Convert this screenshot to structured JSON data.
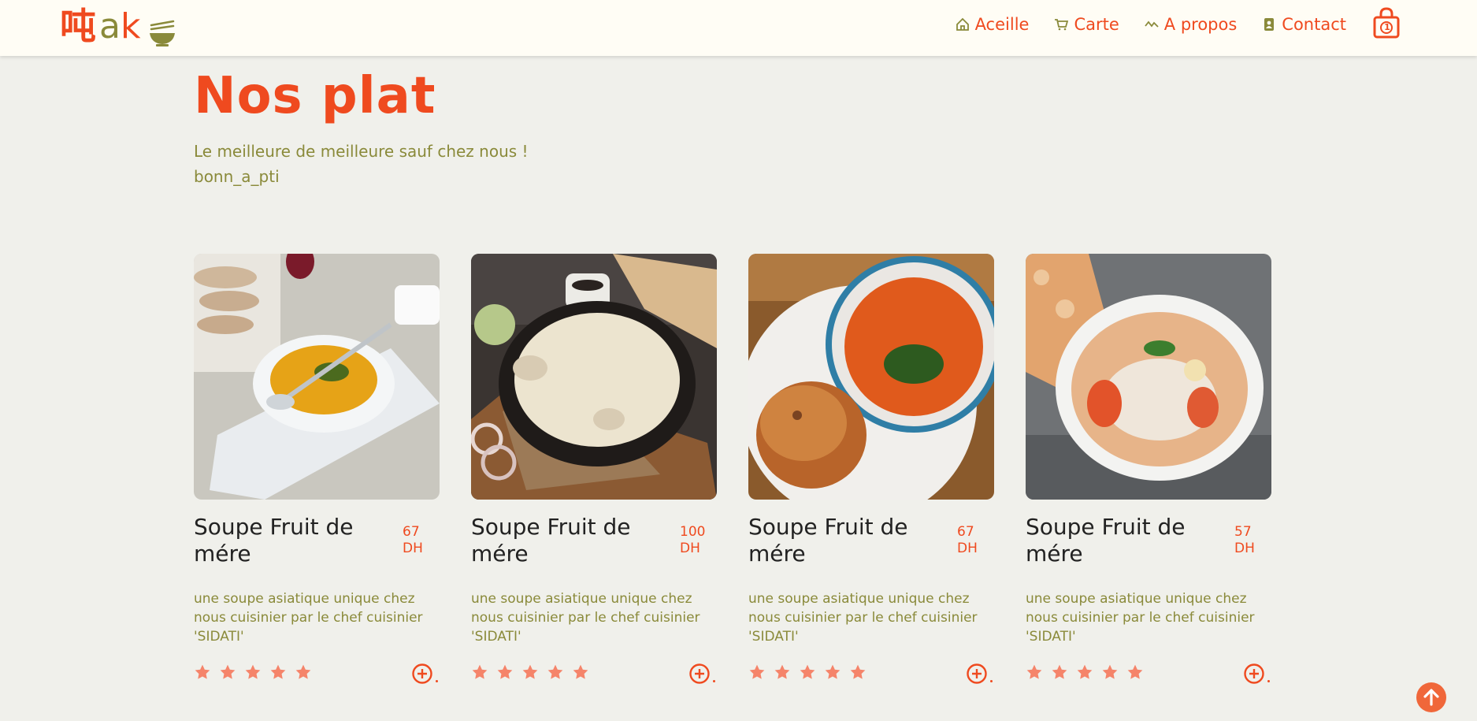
{
  "header": {
    "logo": {
      "cjk": "吨",
      "text_a": "a",
      "text_k": "k"
    },
    "nav": [
      {
        "label": "Aceille",
        "icon": "home-icon"
      },
      {
        "label": "Carte",
        "icon": "cart-icon"
      },
      {
        "label": "A propos",
        "icon": "pulse-icon"
      },
      {
        "label": "Contact",
        "icon": "contact-card-icon"
      }
    ],
    "cart_count": "1"
  },
  "main": {
    "title": "Nos plat",
    "subtitle_line1": "Le meilleure de meilleure sauf chez nous !",
    "subtitle_line2": "bonn_a_pti"
  },
  "products": [
    {
      "name_line1": "Soupe Fruit de",
      "name_line2": "mére",
      "price_value": "67",
      "price_unit": "DH",
      "desc_line1": "une soupe asiatique unique chez",
      "desc_line2": "nous cuisinier par le chef cuisinier",
      "desc_line3": "'SIDATI'",
      "rating": 5
    },
    {
      "name_line1": "Soupe Fruit de",
      "name_line2": "mére",
      "price_value": "100",
      "price_unit": "DH",
      "desc_line1": "une soupe asiatique unique chez",
      "desc_line2": "nous cuisinier par le chef cuisinier",
      "desc_line3": "'SIDATI'",
      "rating": 5
    },
    {
      "name_line1": "Soupe Fruit de",
      "name_line2": "mére",
      "price_value": "67",
      "price_unit": "DH",
      "desc_line1": "une soupe asiatique unique chez",
      "desc_line2": "nous cuisinier par le chef cuisinier",
      "desc_line3": "'SIDATI'",
      "rating": 5
    },
    {
      "name_line1": "Soupe Fruit de",
      "name_line2": "mére",
      "price_value": "57",
      "price_unit": "DH",
      "desc_line1": "une soupe asiatique unique chez",
      "desc_line2": "nous cuisinier par le chef cuisinier",
      "desc_line3": "'SIDATI'",
      "rating": 5
    }
  ],
  "colors": {
    "accent": "#ef4a1f",
    "olive": "#8a8a3a",
    "background": "#f0f0eb",
    "header_bg": "#fffdf5",
    "star": "#f5846a"
  }
}
